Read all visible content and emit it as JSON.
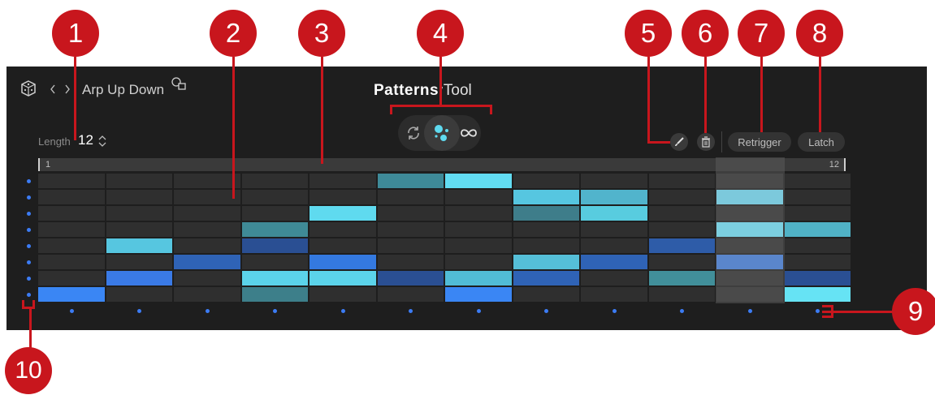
{
  "header": {
    "preset_name": "Arp Up Down",
    "brand_bold": "Patterns",
    "brand_light": "Tool",
    "length_label": "Length",
    "length_value": "12"
  },
  "toolbar": {
    "retrigger_label": "Retrigger",
    "latch_label": "Latch"
  },
  "ruler": {
    "start_label": "1",
    "end_label": "12"
  },
  "pattern": {
    "steps": 12,
    "rows": 8,
    "current_step": 11,
    "cells": [
      {
        "step": 1,
        "row": 8,
        "color": "#3a86f4"
      },
      {
        "step": 2,
        "row": 5,
        "color": "#56c6e0"
      },
      {
        "step": 2,
        "row": 7,
        "color": "#3a7ae6"
      },
      {
        "step": 3,
        "row": 6,
        "color": "#2f63b6"
      },
      {
        "step": 4,
        "row": 4,
        "color": "#3f8a96"
      },
      {
        "step": 4,
        "row": 5,
        "color": "#2a4f93"
      },
      {
        "step": 4,
        "row": 7,
        "color": "#5bd3ea"
      },
      {
        "step": 4,
        "row": 8,
        "color": "#3d7f8a"
      },
      {
        "step": 5,
        "row": 3,
        "color": "#5fdaef"
      },
      {
        "step": 5,
        "row": 6,
        "color": "#3479e0"
      },
      {
        "step": 5,
        "row": 7,
        "color": "#5bd3ea"
      },
      {
        "step": 6,
        "row": 1,
        "color": "#3e8a98"
      },
      {
        "step": 6,
        "row": 7,
        "color": "#2a4f93"
      },
      {
        "step": 7,
        "row": 1,
        "color": "#62dcf2"
      },
      {
        "step": 7,
        "row": 7,
        "color": "#51bcd6"
      },
      {
        "step": 7,
        "row": 8,
        "color": "#3a86f4"
      },
      {
        "step": 8,
        "row": 2,
        "color": "#56c6e0"
      },
      {
        "step": 8,
        "row": 3,
        "color": "#3e7d8a"
      },
      {
        "step": 8,
        "row": 6,
        "color": "#55bfd8"
      },
      {
        "step": 8,
        "row": 7,
        "color": "#2f63b6"
      },
      {
        "step": 9,
        "row": 2,
        "color": "#51b4cc"
      },
      {
        "step": 9,
        "row": 3,
        "color": "#58ccdf"
      },
      {
        "step": 9,
        "row": 6,
        "color": "#2f63b6"
      },
      {
        "step": 10,
        "row": 5,
        "color": "#2e5ca8"
      },
      {
        "step": 10,
        "row": 7,
        "color": "#418f9a"
      },
      {
        "step": 11,
        "row": 2,
        "color": "#7cc9dc"
      },
      {
        "step": 11,
        "row": 4,
        "color": "#7ccfe0"
      },
      {
        "step": 11,
        "row": 6,
        "color": "#5a86cc"
      },
      {
        "step": 12,
        "row": 4,
        "color": "#50b2c6"
      },
      {
        "step": 12,
        "row": 7,
        "color": "#2a4f93"
      },
      {
        "step": 12,
        "row": 8,
        "color": "#66e3f4"
      }
    ]
  },
  "icons": {
    "dice": "dice-icon",
    "prev": "chevron-left-icon",
    "next": "chevron-right-icon",
    "save": "save-preset-icon",
    "stepper": "up-down-stepper-icon",
    "cycle": "cycle-icon",
    "random": "random-dots-icon",
    "infinite": "infinity-icon",
    "brush": "brush-icon",
    "trash": "trash-icon"
  },
  "callouts": [
    "1",
    "2",
    "3",
    "4",
    "5",
    "6",
    "7",
    "8",
    "9",
    "10"
  ],
  "colors": {
    "accent_blue": "#3c7cf5",
    "accent_cyan": "#5fdaef",
    "callout_red": "#c8161d",
    "empty_cell": "#2f2f2f",
    "current_column": "#5a5a5a"
  }
}
